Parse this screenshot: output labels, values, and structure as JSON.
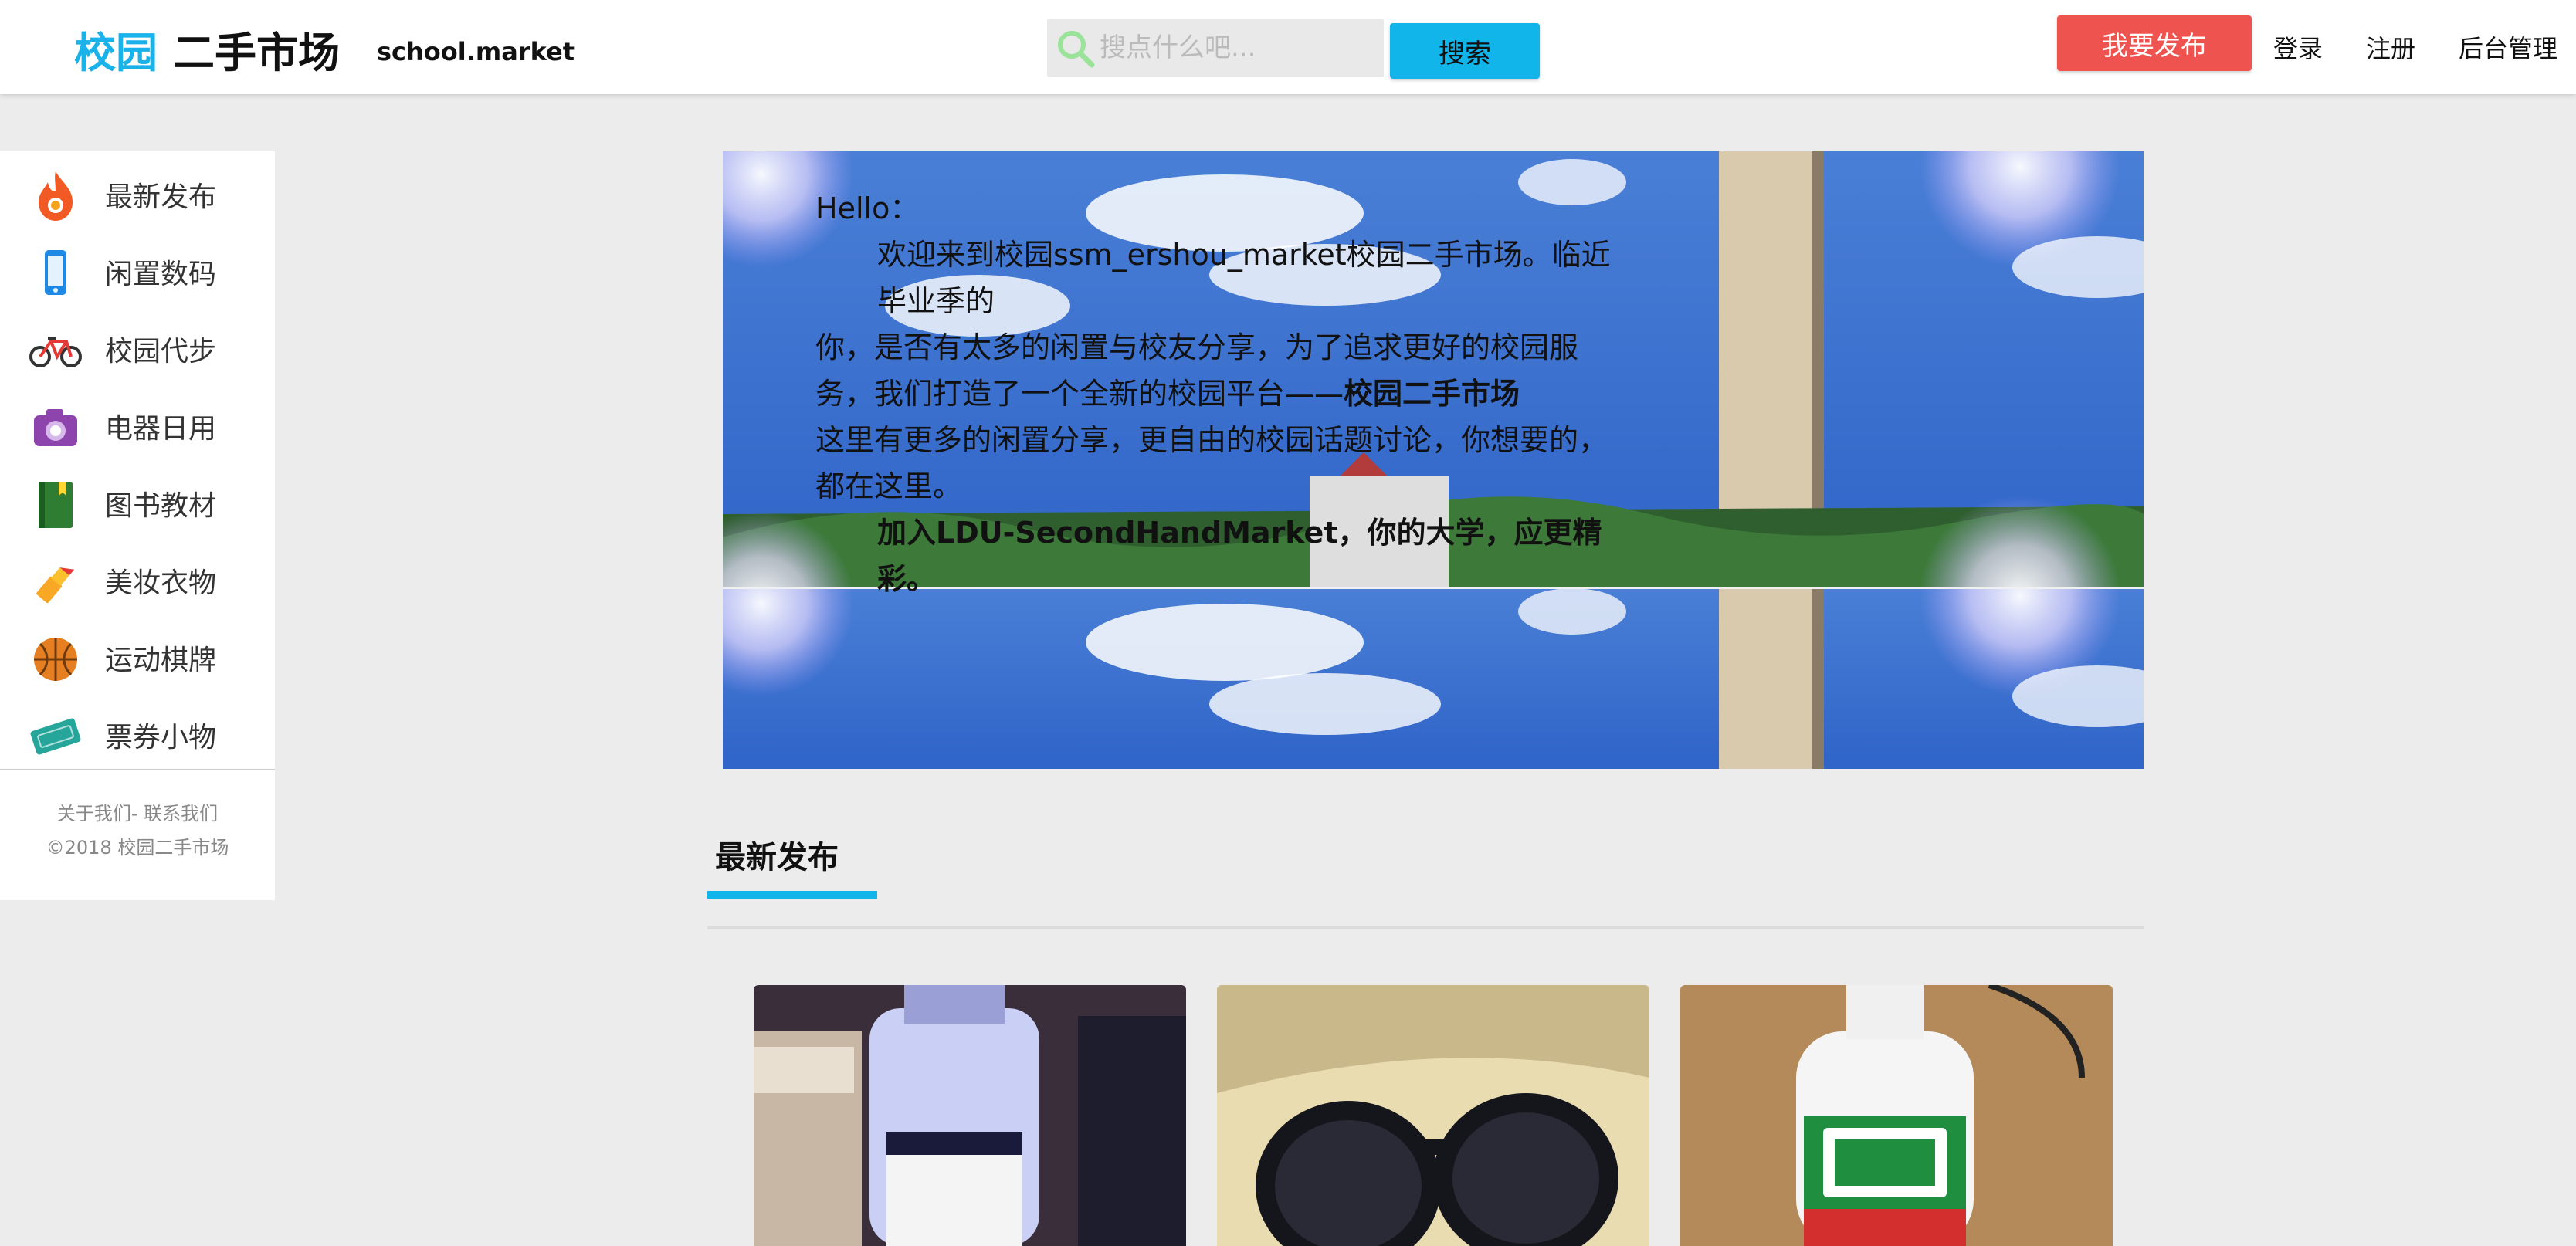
{
  "header": {
    "logo_part1": "校园",
    "logo_part2": "二手市场",
    "domain": "school.market",
    "search_placeholder": "搜点什么吧...",
    "search_button": "搜索",
    "publish_button": "我要发布",
    "links": [
      "登录",
      "注册",
      "后台管理"
    ]
  },
  "sidebar": {
    "items": [
      {
        "label": "最新发布",
        "icon": "fire-icon"
      },
      {
        "label": "闲置数码",
        "icon": "phone-icon"
      },
      {
        "label": "校园代步",
        "icon": "bicycle-icon"
      },
      {
        "label": "电器日用",
        "icon": "camera-icon"
      },
      {
        "label": "图书教材",
        "icon": "book-icon"
      },
      {
        "label": "美妆衣物",
        "icon": "lipstick-icon"
      },
      {
        "label": "运动棋牌",
        "icon": "basketball-icon"
      },
      {
        "label": "票券小物",
        "icon": "ticket-icon"
      }
    ],
    "footer_line1": "关于我们- 联系我们",
    "footer_line2": "©2018 校园二手市场"
  },
  "banner": {
    "hello": "Hello：",
    "line1": "欢迎来到校园ssm_ershou_market校园二手市场。临近毕业季的",
    "line2a": "你，是否有太多的闲置与校友分享，为了追求更好的校园服务，我们打造了一个全新的校园平台——",
    "line2b": "校园二手市场",
    "line3": "这里有更多的闲置分享，更自由的校园话题讨论，你想要的，都在这里。",
    "line4": "加入LDU-SecondHandMarket，你的大学，应更精彩。"
  },
  "latest": {
    "title": "最新发布"
  },
  "products": [
    {
      "image": "sunscreen-bottle-photo"
    },
    {
      "image": "sunglasses-photo"
    },
    {
      "image": "opti-free-bottle-photo"
    }
  ],
  "colors": {
    "brand_blue": "#1ab2e8",
    "search_button": "#12b5ea",
    "publish_button": "#ef5350"
  }
}
